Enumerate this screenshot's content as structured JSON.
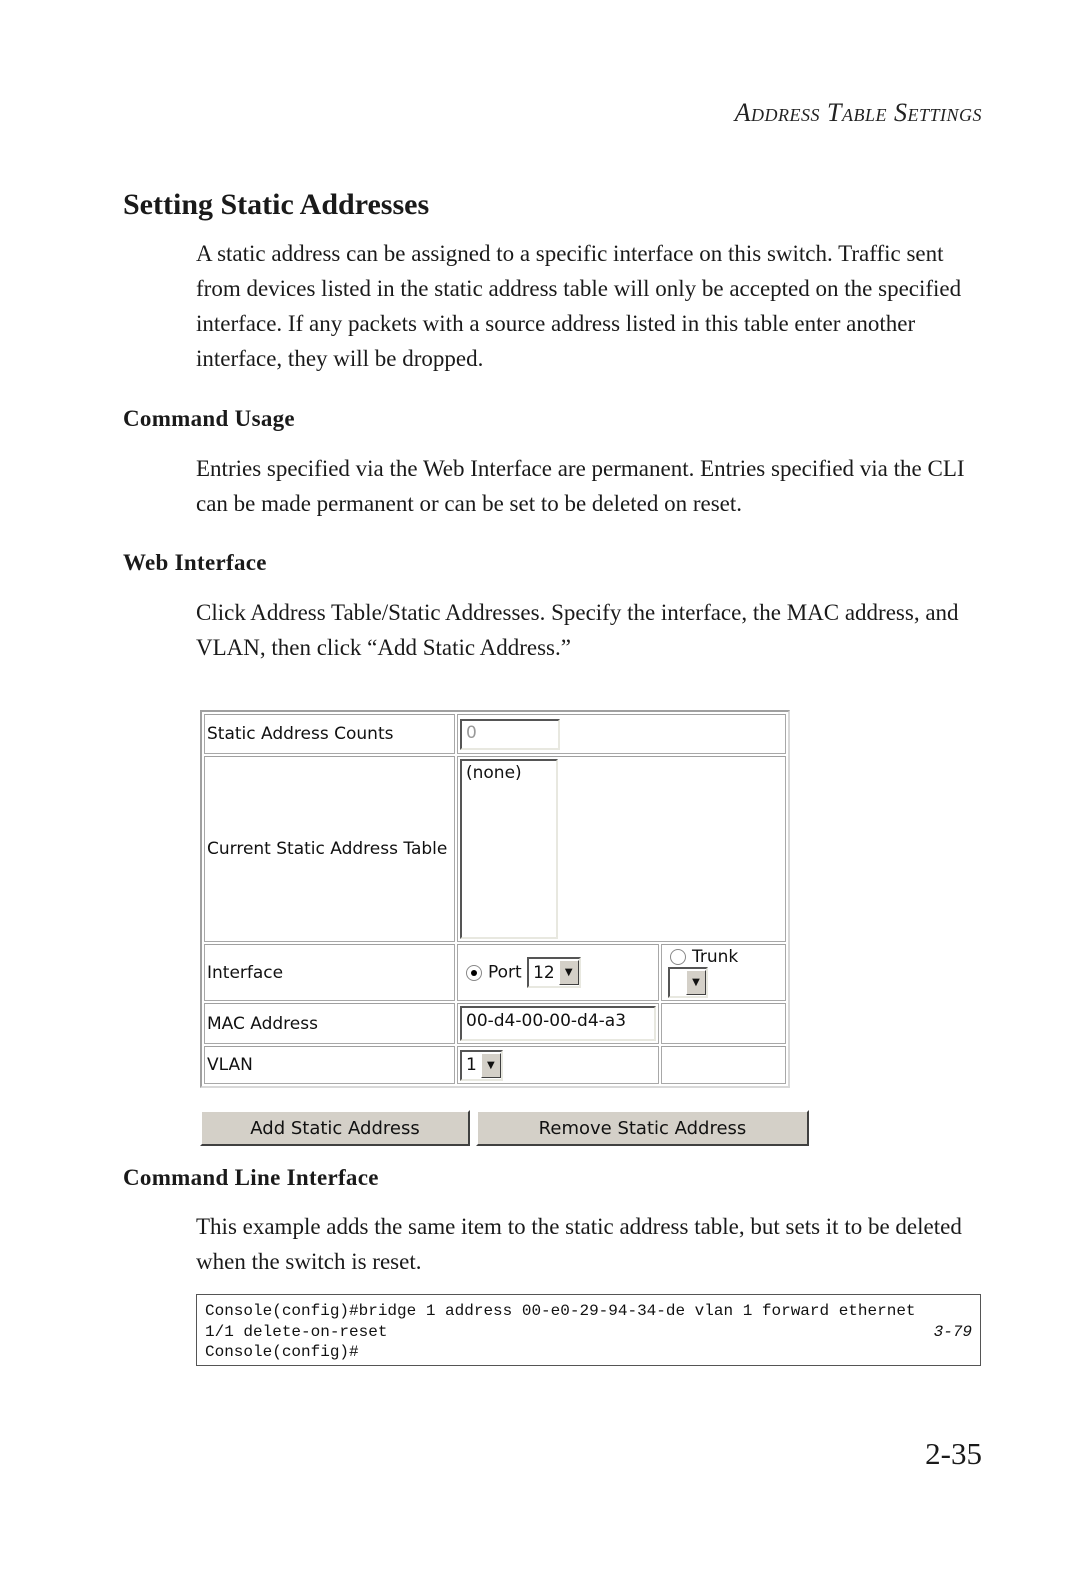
{
  "running_head": "Address Table Settings",
  "section_title": "Setting Static Addresses",
  "intro_paragraph": "A static address can be assigned to a specific interface on this switch. Traffic sent from devices listed in the static address table will only be accepted on the specified interface. If any packets with a source address listed in this table enter another interface, they will be dropped.",
  "command_usage": {
    "heading": "Command Usage",
    "text": "Entries specified via the Web Interface are permanent. Entries specified via the CLI can be made permanent or can be set to be deleted on reset."
  },
  "web_interface": {
    "heading": "Web Interface",
    "text": "Click Address Table/Static Addresses. Specify the interface, the MAC address, and VLAN, then click “Add Static Address.”"
  },
  "form": {
    "static_count_label": "Static Address Counts",
    "static_count_value": "0",
    "current_table_label": "Current Static Address Table",
    "current_table_items": [
      "(none)"
    ],
    "interface_label": "Interface",
    "port_radio_label": "Port",
    "port_selected": true,
    "port_value": "12",
    "trunk_radio_label": "Trunk",
    "trunk_selected": false,
    "trunk_value": "",
    "mac_label": "MAC Address",
    "mac_value": "00-d4-00-00-d4-a3",
    "vlan_label": "VLAN",
    "vlan_value": "1",
    "add_button": "Add Static Address",
    "remove_button": "Remove Static Address"
  },
  "cli": {
    "heading": "Command Line Interface",
    "text": "This example adds the same item to the static address table, but sets it to be deleted when the switch is reset.",
    "lines": [
      {
        "text": "Console(config)#bridge 1 address 00-e0-29-94-34-de vlan 1 forward ethernet",
        "ref": ""
      },
      {
        "text": "1/1 delete-on-reset",
        "ref": "3-79"
      },
      {
        "text": "Console(config)#",
        "ref": ""
      }
    ]
  },
  "page_number": "2-35"
}
